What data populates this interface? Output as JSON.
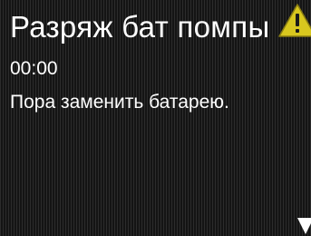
{
  "alert": {
    "title": "Разряж бат помпы",
    "time": "00:00",
    "message": "Пора заменить батарею.",
    "icon": "warning-triangle-icon"
  },
  "controls": {
    "scroll_indicator": "scroll-down-arrow-icon"
  },
  "colors": {
    "background": "#141414",
    "text": "#ffffff",
    "warning": "#d8c71e"
  }
}
